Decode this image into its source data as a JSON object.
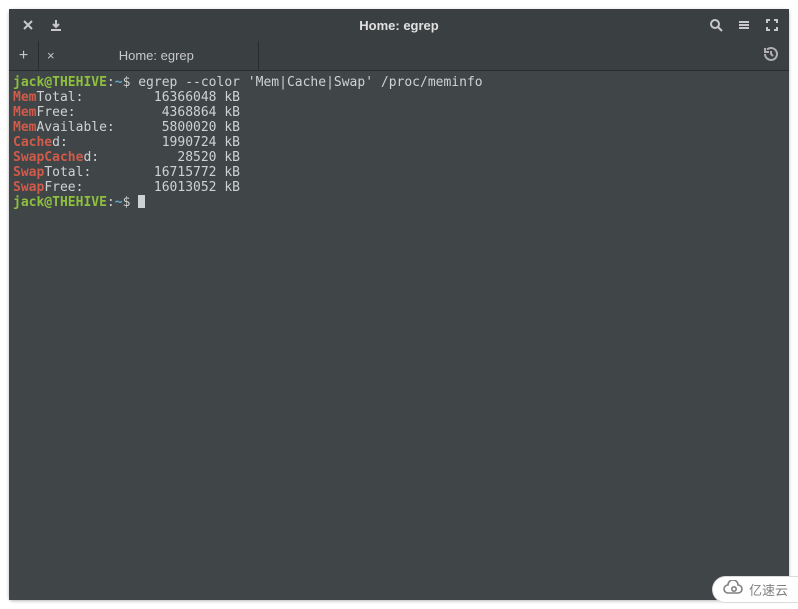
{
  "window": {
    "title": "Home: egrep"
  },
  "tabs": {
    "items": [
      {
        "label": "Home: egrep"
      }
    ]
  },
  "prompt": {
    "user": "jack",
    "host": "THEHIVE",
    "path": "~",
    "symbol": "$"
  },
  "command": {
    "bin": "egrep",
    "flag": "--color",
    "pattern": "'Mem|Cache|Swap'",
    "target": "/proc/meminfo"
  },
  "output": {
    "lines": [
      {
        "hl": "Mem",
        "plain": "Total:",
        "pad": "         ",
        "value": "16366048",
        "unit": "kB"
      },
      {
        "hl": "Mem",
        "plain": "Free:",
        "pad": "           ",
        "value": "4368864",
        "unit": "kB"
      },
      {
        "hl": "Mem",
        "plain": "Available:",
        "pad": "      ",
        "value": "5800020",
        "unit": "kB"
      },
      {
        "hl": "Cache",
        "plain": "d:",
        "pad": "            ",
        "value": "1990724",
        "unit": "kB"
      },
      {
        "hl": "SwapCache",
        "plain": "d:",
        "pad": "          ",
        "value": "28520",
        "unit": "kB"
      },
      {
        "hl": "Swap",
        "plain": "Total:",
        "pad": "        ",
        "value": "16715772",
        "unit": "kB"
      },
      {
        "hl": "Swap",
        "plain": "Free:",
        "pad": "         ",
        "value": "16013052",
        "unit": "kB"
      }
    ]
  },
  "watermark": {
    "text": "亿速云"
  }
}
